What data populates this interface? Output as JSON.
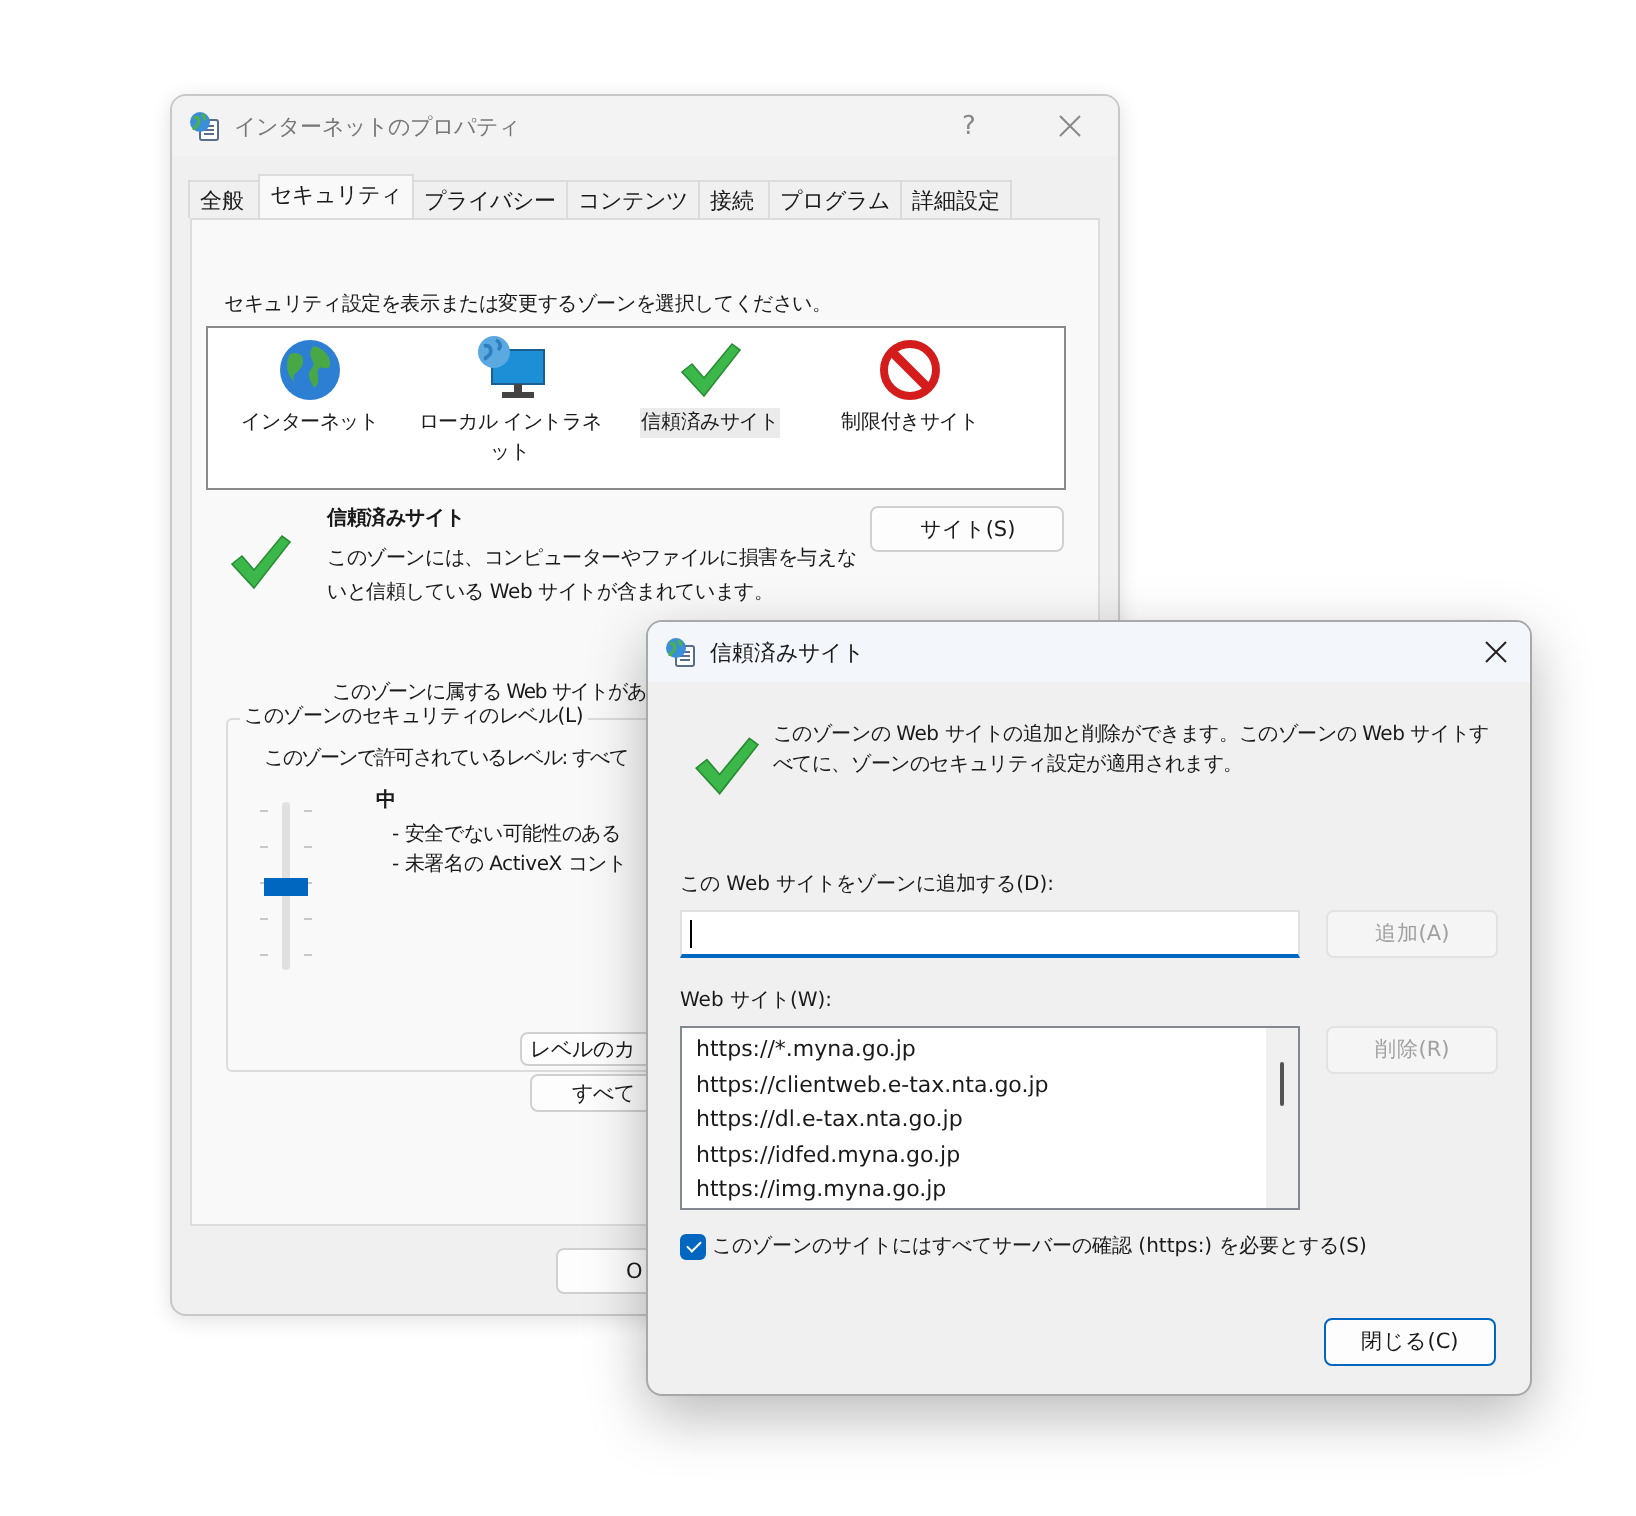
{
  "back_window": {
    "title": "インターネットのプロパティ",
    "help": "?",
    "tabs": [
      {
        "label": "全般",
        "selected": false
      },
      {
        "label": "セキュリティ",
        "selected": true
      },
      {
        "label": "プライバシー",
        "selected": false
      },
      {
        "label": "コンテンツ",
        "selected": false
      },
      {
        "label": "接続",
        "selected": false
      },
      {
        "label": "プログラム",
        "selected": false
      },
      {
        "label": "詳細設定",
        "selected": false
      }
    ],
    "instruction": "セキュリティ設定を表示または変更するゾーンを選択してください。",
    "zones": [
      {
        "label": "インターネット",
        "kind": "globe",
        "selected": false
      },
      {
        "label": "ローカル イントラネット",
        "kind": "intranet",
        "selected": false
      },
      {
        "label": "信頼済みサイト",
        "kind": "check",
        "selected": true
      },
      {
        "label": "制限付きサイト",
        "kind": "blocked",
        "selected": false
      }
    ],
    "zone_title": "信頼済みサイト",
    "zone_description": "このゾーンには、コンピューターやファイルに損害を与えないと信頼している Web サイトが含まれています。",
    "sites_button": "サイト(S)",
    "sites_note": "このゾーンに属する Web サイトがあ",
    "level_group": {
      "legend": "このゾーンのセキュリティのレベル(L)",
      "allowed": "このゾーンで許可されているレベル: すべて",
      "level": 0.5,
      "level_name": "中",
      "bullets": [
        "- 安全でない可能性のある",
        "- 未署名の ActiveX コント"
      ],
      "custom_button": "レベルのカ"
    },
    "default_button": "すべて",
    "ok_button": "O"
  },
  "front_window": {
    "title": "信頼済みサイト",
    "description": "このゾーンの Web サイトの追加と削除ができます。このゾーンの Web サイトすべてに、ゾーンのセキュリティ設定が適用されます。",
    "add_label": "この Web サイトをゾーンに追加する(D):",
    "add_field": {
      "focused": true
    },
    "add_button": {
      "label": "追加(A)",
      "disabled": true
    },
    "list_label": "Web サイト(W):",
    "sites": [
      "https://*.myna.go.jp",
      "https://clientweb.e-tax.nta.go.jp",
      "https://dl.e-tax.nta.go.jp",
      "https://idfed.myna.go.jp",
      "https://img.myna.go.jp"
    ],
    "remove_button": {
      "label": "削除(R)",
      "disabled": true
    },
    "require_https": {
      "label": "このゾーンのサイトにはすべてサーバーの確認 (https:) を必要とする(S)",
      "checked": true
    },
    "close_button": "閉じる(C)"
  }
}
